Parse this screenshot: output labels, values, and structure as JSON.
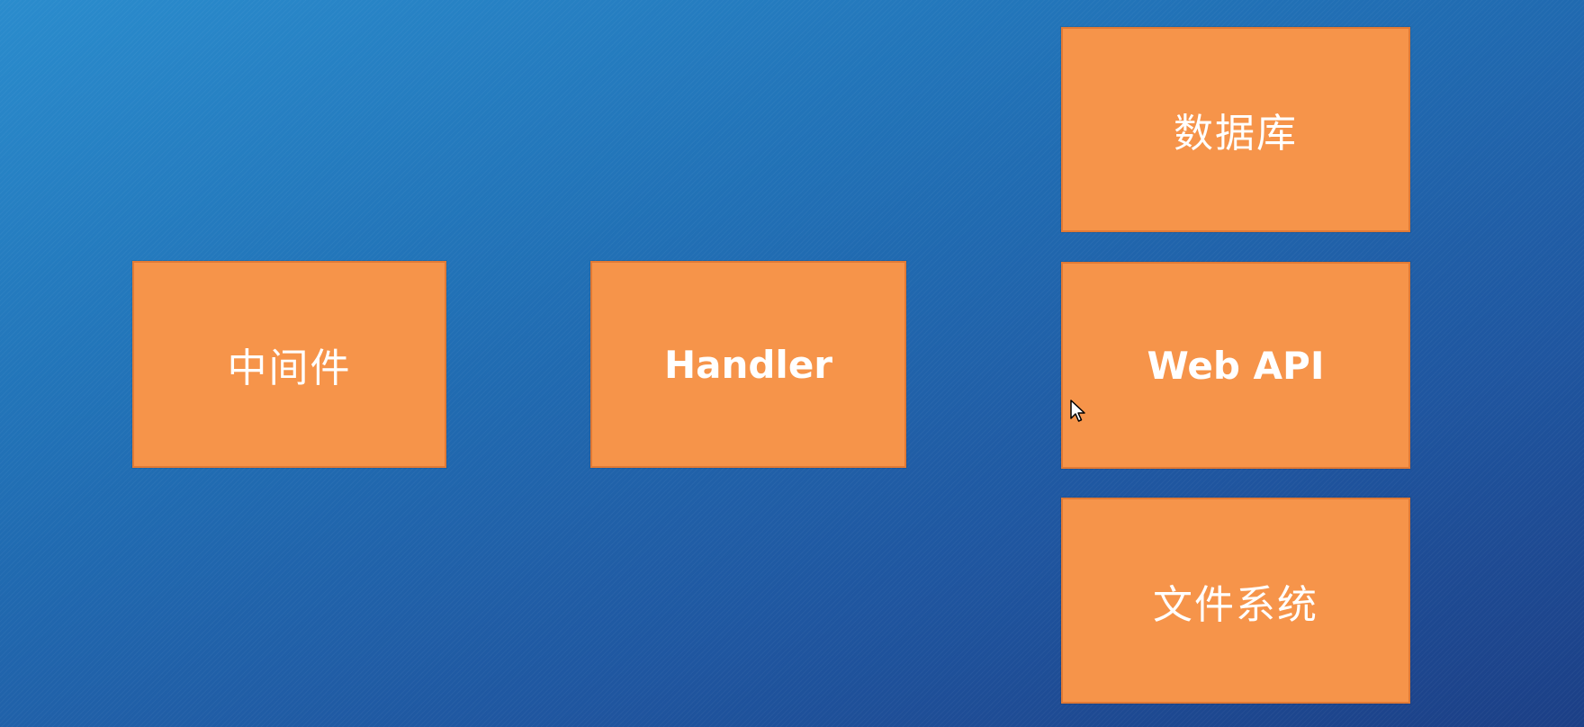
{
  "boxes": {
    "middleware": "中间件",
    "handler": "Handler",
    "database": "数据库",
    "webapi": "Web API",
    "filesystem": "文件系统"
  },
  "colors": {
    "box_fill": "#f6944a",
    "box_border": "#e17a35",
    "text": "#ffffff",
    "background_start": "#2a8ccd",
    "background_end": "#1c3f86"
  },
  "icons": {
    "cursor": "mouse-pointer-icon"
  }
}
